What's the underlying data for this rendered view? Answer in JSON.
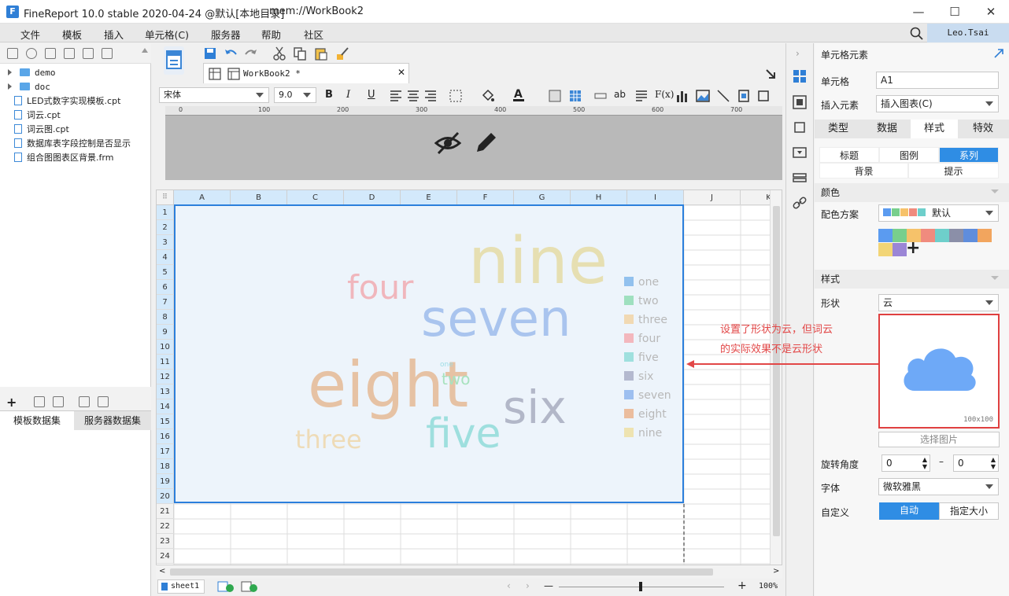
{
  "window": {
    "title": "FineReport 10.0 stable 2020-04-24 @默认[本地目录]",
    "path": "mem://WorkBook2",
    "minimize": "—",
    "maximize": "☐",
    "close": "✕"
  },
  "menu": [
    "文件",
    "模板",
    "插入",
    "单元格(C)",
    "服务器",
    "帮助",
    "社区"
  ],
  "user": "Leo.Tsai",
  "tree": {
    "items": [
      {
        "label": "demo",
        "type": "folder"
      },
      {
        "label": "doc",
        "type": "folder"
      },
      {
        "label": "LED式数字实现模板.cpt",
        "type": "file"
      },
      {
        "label": "词云.cpt",
        "type": "file"
      },
      {
        "label": "词云图.cpt",
        "type": "file"
      },
      {
        "label": "数据库表字段控制是否显示",
        "type": "file"
      },
      {
        "label": "组合图图表区背景.frm",
        "type": "file"
      }
    ]
  },
  "dataset_tabs": [
    "模板数据集",
    "服务器数据集"
  ],
  "editor": {
    "tab_label": "WorkBook2 *",
    "font_name": "宋体",
    "font_size": "9.0",
    "bold": "B",
    "italic": "I",
    "underline": "U"
  },
  "ruler": [
    "0",
    "100",
    "200",
    "300",
    "400",
    "500",
    "600",
    "700"
  ],
  "columns": [
    "A",
    "B",
    "C",
    "D",
    "E",
    "F",
    "G",
    "H",
    "I",
    "J",
    "K"
  ],
  "rows": [
    "1",
    "2",
    "3",
    "4",
    "5",
    "6",
    "7",
    "8",
    "9",
    "10",
    "11",
    "12",
    "13",
    "14",
    "15",
    "16",
    "17",
    "18",
    "19",
    "20",
    "21",
    "22",
    "23",
    "24"
  ],
  "sheet": {
    "name": "sheet1",
    "zoom": "100%",
    "zoom_minus": "—",
    "zoom_plus": "+"
  },
  "chart_data": {
    "type": "wordcloud",
    "words": [
      {
        "text": "nine",
        "color": "#e6dfb2"
      },
      {
        "text": "seven",
        "color": "#a9c4ee"
      },
      {
        "text": "eight",
        "color": "#e6c2a4"
      },
      {
        "text": "six",
        "color": "#b2b7c8"
      },
      {
        "text": "five",
        "color": "#9edfde"
      },
      {
        "text": "four",
        "color": "#f0b6bc"
      },
      {
        "text": "three",
        "color": "#eedbb7"
      },
      {
        "text": "two",
        "color": "#a8e2be"
      },
      {
        "text": "one",
        "color": "#9ddde6"
      }
    ],
    "legend": [
      {
        "label": "one",
        "color": "#92c1ee"
      },
      {
        "label": "two",
        "color": "#9fe0bf"
      },
      {
        "label": "three",
        "color": "#f1d9b3"
      },
      {
        "label": "four",
        "color": "#f3b7bd"
      },
      {
        "label": "five",
        "color": "#9fe0de"
      },
      {
        "label": "six",
        "color": "#b4b9cf"
      },
      {
        "label": "seven",
        "color": "#9dbff0"
      },
      {
        "label": "eight",
        "color": "#ebbd9e"
      },
      {
        "label": "nine",
        "color": "#eee3b1"
      }
    ],
    "legend_position": "right"
  },
  "panel": {
    "title": "单元格元素",
    "cell_label": "单元格",
    "cell_value": "A1",
    "insert_label": "插入元素",
    "insert_value": "插入图表(C)",
    "tabs": [
      "类型",
      "数据",
      "样式",
      "特效"
    ],
    "active_tab": "样式",
    "subtabs_row1": [
      "标题",
      "图例",
      "系列"
    ],
    "subtabs_row2": [
      "背景",
      "提示"
    ],
    "active_subtab": "系列",
    "color_section": "颜色",
    "scheme_label": "配色方案",
    "scheme_value": "默认",
    "palette": [
      "#5b9bf0",
      "#78cf8d",
      "#f6c26a",
      "#f08b7e",
      "#6ecfcb",
      "#8b8fa8",
      "#5f8ddc",
      "#f2a55e",
      "#f2d576",
      "#9b86d6"
    ],
    "add": "+",
    "style_section": "样式",
    "shape_label": "形状",
    "shape_value": "云",
    "shape_icon": "cloud-icon",
    "image_size": "100x100",
    "select_image": "选择图片",
    "rotate_label": "旋转角度",
    "rotate_from": "0",
    "rotate_dash": "–",
    "rotate_to": "0",
    "font_label": "字体",
    "font_value": "微软雅黑",
    "custom_label": "自定义",
    "auto": "自动",
    "specify_size": "指定大小"
  },
  "annotation": {
    "line1": "设置了形状为云，但词云",
    "line2": "的实际效果不是云形状",
    "color": "#e24747"
  }
}
